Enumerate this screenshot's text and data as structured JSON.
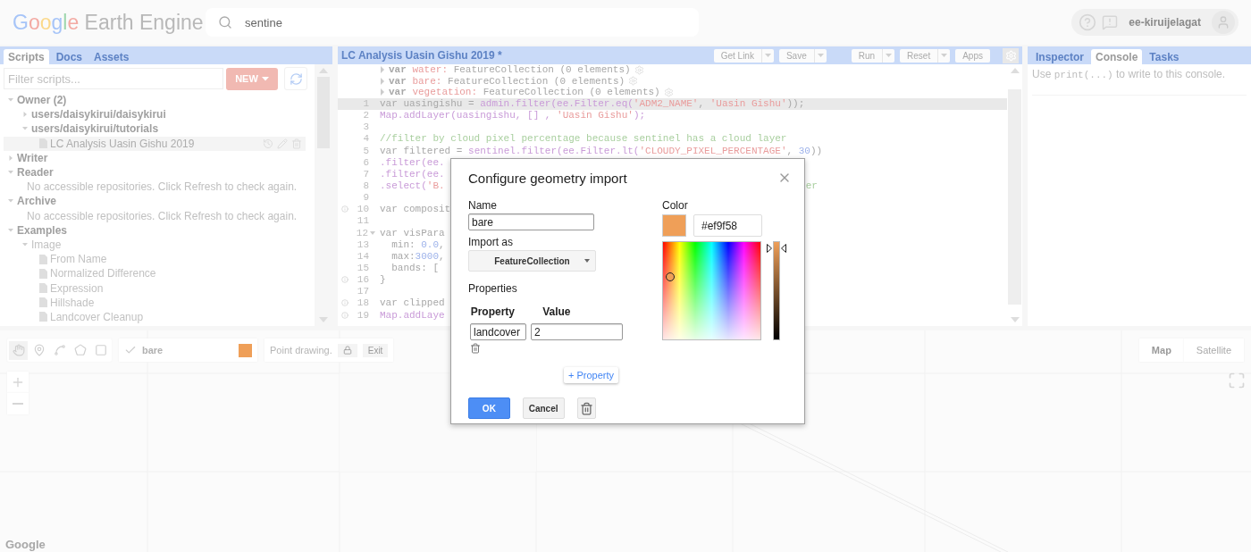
{
  "header": {
    "logo": {
      "brand": "Google",
      "product": "Earth Engine"
    },
    "search": {
      "value": "sentine"
    },
    "account": {
      "user": "ee-kiruijelagat"
    }
  },
  "scripts_panel": {
    "tabs": [
      {
        "label": "Scripts",
        "selected": true
      },
      {
        "label": "Docs",
        "selected": false
      },
      {
        "label": "Assets",
        "selected": false
      }
    ],
    "filter": {
      "placeholder": "Filter scripts..."
    },
    "new_button": "NEW",
    "tree": [
      {
        "kind": "folder",
        "label": "Owner (2)",
        "expanded": true,
        "muted": false,
        "children": [
          {
            "kind": "folder",
            "label": "users/daisykirui/daisykirui",
            "expanded": false,
            "muted": false
          },
          {
            "kind": "folder",
            "label": "users/daisykirui/tutorials",
            "expanded": true,
            "muted": false,
            "children": [
              {
                "kind": "file",
                "label": "LC Analysis Uasin Gishu 2019",
                "selected": true,
                "muted": false
              }
            ]
          }
        ]
      },
      {
        "kind": "folder",
        "label": "Writer",
        "expanded": false,
        "muted": false
      },
      {
        "kind": "folder",
        "label": "Reader",
        "expanded": true,
        "muted": false,
        "children": [
          {
            "kind": "message",
            "label": "No accessible repositories. Click Refresh to check again."
          }
        ]
      },
      {
        "kind": "folder",
        "label": "Archive",
        "expanded": true,
        "muted": false,
        "children": [
          {
            "kind": "message",
            "label": "No accessible repositories. Click Refresh to check again."
          }
        ]
      },
      {
        "kind": "folder",
        "label": "Examples",
        "expanded": true,
        "muted": false,
        "children": [
          {
            "kind": "folder",
            "label": "Image",
            "expanded": true,
            "muted": true,
            "children": [
              {
                "kind": "file",
                "label": "From Name",
                "selected": false,
                "muted": true
              },
              {
                "kind": "file",
                "label": "Normalized Difference",
                "selected": false,
                "muted": true
              },
              {
                "kind": "file",
                "label": "Expression",
                "selected": false,
                "muted": true
              },
              {
                "kind": "file",
                "label": "Hillshade",
                "selected": false,
                "muted": true
              },
              {
                "kind": "file",
                "label": "Landcover Cleanup",
                "selected": false,
                "muted": true
              }
            ]
          }
        ]
      }
    ]
  },
  "editor": {
    "title": "LC Analysis Uasin Gishu 2019 *",
    "buttons": [
      {
        "label": "Get Link",
        "dropdown": true
      },
      {
        "label": "Save",
        "dropdown": true
      },
      {
        "label": "Run",
        "dropdown": true
      },
      {
        "label": "Reset",
        "dropdown": true
      },
      {
        "label": "Apps",
        "dropdown": false
      }
    ],
    "imports": [
      {
        "keyword": "var",
        "name": "water:",
        "value": "FeatureCollection (0 elements)"
      },
      {
        "keyword": "var",
        "name": "bare:",
        "value": "FeatureCollection (0 elements)"
      },
      {
        "keyword": "var",
        "name": "vegetation:",
        "value": "FeatureCollection (0 elements)"
      }
    ],
    "lines": [
      {
        "n": "1",
        "current": true,
        "info": false,
        "fold": false,
        "s": [
          {
            "kind": "plain",
            "text": "var uasingishu = "
          },
          {
            "kind": "call",
            "text": "admin.filter(ee.Filter.eq("
          },
          {
            "kind": "string",
            "text": "'ADM2_NAME'"
          },
          {
            "kind": "plain",
            "text": ", "
          },
          {
            "kind": "string",
            "text": "'Uasin Gishu'"
          },
          {
            "kind": "plain",
            "text": "));"
          }
        ]
      },
      {
        "n": "2",
        "current": false,
        "info": false,
        "fold": false,
        "s": [
          {
            "kind": "call",
            "text": "Map.addLayer(uasingishu, [] , "
          },
          {
            "kind": "string",
            "text": "'Uasin Gishu'"
          },
          {
            "kind": "call",
            "text": ");"
          }
        ]
      },
      {
        "n": "3",
        "current": false,
        "info": false,
        "fold": false
      },
      {
        "n": "4",
        "current": false,
        "info": false,
        "fold": false,
        "s": [
          {
            "kind": "comment",
            "text": "//filter by cloud pixel percentage because sentinel has a cloud layer"
          }
        ]
      },
      {
        "n": "5",
        "current": false,
        "info": false,
        "fold": false,
        "s": [
          {
            "kind": "plain",
            "text": "var filtered = "
          },
          {
            "kind": "call",
            "text": "sentinel.filter(ee.Filter.lt("
          },
          {
            "kind": "string",
            "text": "'CLOUDY_PIXEL_PERCENTAGE'"
          },
          {
            "kind": "plain",
            "text": ", "
          },
          {
            "kind": "number",
            "text": "30"
          },
          {
            "kind": "plain",
            "text": "))"
          }
        ]
      },
      {
        "n": "6",
        "current": false,
        "info": false,
        "fold": false,
        "s": [
          {
            "kind": "call",
            "text": ".filter(ee."
          }
        ]
      },
      {
        "n": "7",
        "current": false,
        "info": false,
        "fold": false,
        "s": [
          {
            "kind": "call",
            "text": ".filter(ee."
          }
        ]
      },
      {
        "n": "8",
        "current": false,
        "info": false,
        "fold": false,
        "s": [
          {
            "kind": "call",
            "text": ".select("
          },
          {
            "kind": "string",
            "text": "'B."
          }
        ],
        "tail": {
          "kind": "comment",
          "text": "er"
        }
      },
      {
        "n": "9",
        "current": false,
        "info": false,
        "fold": false
      },
      {
        "n": "10",
        "current": false,
        "info": true,
        "fold": false,
        "s": [
          {
            "kind": "plain",
            "text": "var composit"
          }
        ]
      },
      {
        "n": "11",
        "current": false,
        "info": false,
        "fold": false
      },
      {
        "n": "12",
        "current": false,
        "info": false,
        "fold": true,
        "s": [
          {
            "kind": "plain",
            "text": "var visPara"
          }
        ]
      },
      {
        "n": "13",
        "current": false,
        "info": false,
        "fold": false,
        "s": [
          {
            "kind": "plain",
            "text": "  min: "
          },
          {
            "kind": "number",
            "text": "0.0"
          },
          {
            "kind": "plain",
            "text": ","
          }
        ]
      },
      {
        "n": "14",
        "current": false,
        "info": false,
        "fold": false,
        "s": [
          {
            "kind": "plain",
            "text": "  max:"
          },
          {
            "kind": "number",
            "text": "3000"
          },
          {
            "kind": "plain",
            "text": ","
          }
        ]
      },
      {
        "n": "15",
        "current": false,
        "info": false,
        "fold": false,
        "s": [
          {
            "kind": "plain",
            "text": "  bands: ["
          }
        ]
      },
      {
        "n": "16",
        "current": false,
        "info": true,
        "fold": false,
        "s": [
          {
            "kind": "plain",
            "text": "}"
          }
        ]
      },
      {
        "n": "17",
        "current": false,
        "info": false,
        "fold": false
      },
      {
        "n": "18",
        "current": false,
        "info": true,
        "fold": false,
        "s": [
          {
            "kind": "plain",
            "text": "var clipped"
          }
        ]
      },
      {
        "n": "19",
        "current": false,
        "info": true,
        "fold": false,
        "s": [
          {
            "kind": "call",
            "text": "Map.addLaye"
          }
        ]
      }
    ]
  },
  "console_panel": {
    "tabs": [
      {
        "label": "Inspector",
        "selected": false
      },
      {
        "label": "Console",
        "selected": true
      },
      {
        "label": "Tasks",
        "selected": false
      }
    ],
    "hint": {
      "before": "Use ",
      "code": "print(...)",
      "after": " to write to this console."
    }
  },
  "map": {
    "layer": {
      "name": "bare",
      "checked": true,
      "color": "#ef9f58"
    },
    "drawing_status": "Point drawing.",
    "exit_button": "Exit",
    "map_types": [
      {
        "label": "Map",
        "selected": true
      },
      {
        "label": "Satellite",
        "selected": false
      }
    ],
    "logo": "Google"
  },
  "dialog": {
    "title": "Configure geometry import",
    "name": {
      "label": "Name",
      "value": "bare"
    },
    "import_as": {
      "label": "Import as",
      "value": "FeatureCollection"
    },
    "properties": {
      "label": "Properties",
      "columns": [
        "Property",
        "Value"
      ],
      "rows": [
        {
          "property": "landcover",
          "value": "2"
        }
      ],
      "add_button": "+ Property"
    },
    "color": {
      "label": "Color",
      "hex": "#ef9f58",
      "brightness": {
        "level": 0.97
      }
    },
    "buttons": {
      "ok": "OK",
      "cancel": "Cancel"
    }
  }
}
